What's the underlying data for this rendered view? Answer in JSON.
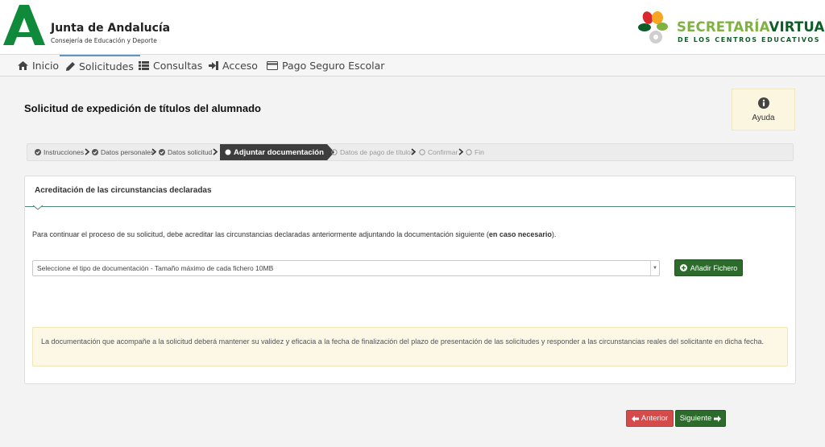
{
  "header": {
    "brand_title": "Junta de Andalucía",
    "brand_subtitle": "Consejería de Educación y Deporte",
    "sv_title_part1": "SECRETARÍA",
    "sv_title_part2": "VIRTUAL",
    "sv_subtitle": "DE LOS CENTROS EDUCATIVOS"
  },
  "nav": {
    "items": [
      {
        "label": "Inicio",
        "icon": "home-icon"
      },
      {
        "label": "Solicitudes",
        "icon": "pencil-icon"
      },
      {
        "label": "Consultas",
        "icon": "list-icon"
      },
      {
        "label": "Acceso",
        "icon": "sign-in-icon"
      },
      {
        "label": "Pago Seguro Escolar",
        "icon": "credit-card-icon"
      }
    ],
    "active": "Solicitudes"
  },
  "page": {
    "title": "Solicitud de expedición de títulos del alumnado",
    "help_label": "Ayuda"
  },
  "steps": [
    {
      "label": "Instrucciones",
      "state": "done"
    },
    {
      "label": "Datos personales",
      "state": "done"
    },
    {
      "label": "Datos solicitud",
      "state": "done"
    },
    {
      "label": "Adjuntar documentación",
      "state": "active"
    },
    {
      "label": "Datos de pago de títulos",
      "state": "pending"
    },
    {
      "label": "Confirmar",
      "state": "pending"
    },
    {
      "label": "Fin",
      "state": "pending"
    }
  ],
  "panel": {
    "title": "Acreditación de las circunstancias declaradas",
    "intro_text": "Para continuar el proceso de su solicitud, debe acreditar las circunstancias declaradas anteriormente adjuntando la documentación siguiente (",
    "intro_bold": "en caso necesario",
    "intro_end": ").",
    "select_value": "Seleccione el tipo de documentación - Tamaño máximo de cada fichero 10MB",
    "add_button": "Añadir Fichero",
    "notice": "La documentación que acompañe a la solicitud deberá mantener su validez y eficacia a la fecha de finalización del plazo de presentación de las solicitudes y responder a las circunstancias reales del solicitante en dicha fecha."
  },
  "footer": {
    "prev_label": "Anterior",
    "next_label": "Siguiente"
  },
  "colors": {
    "green_brand": "#0e5d27",
    "light_green": "#7fb241",
    "button_green": "#2d6b2d",
    "button_red": "#d34b4b",
    "nav_active": "#5f96c4"
  }
}
